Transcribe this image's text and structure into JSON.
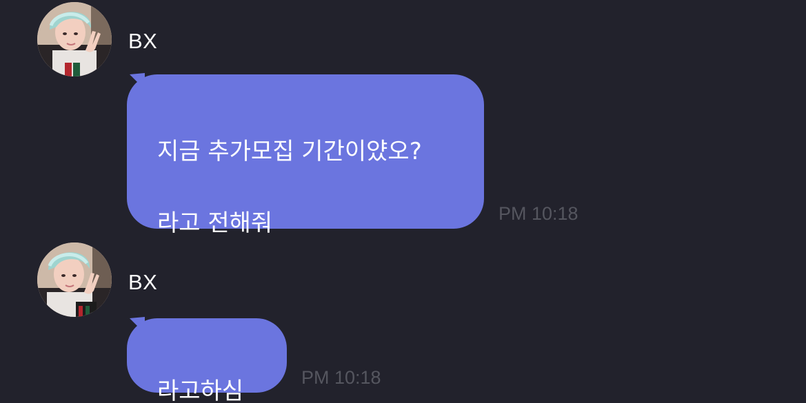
{
  "theme": {
    "background": "#22222c",
    "bubble_color": "#6b75df",
    "text_color": "#ffffff",
    "time_color": "#55565f"
  },
  "messages": [
    {
      "sender": "BX",
      "avatar_icon": "profile-photo-avatar",
      "text": "지금 추가모집 기간이얐오?\n\n라고 전해줘",
      "time": "PM 10:18"
    },
    {
      "sender": "BX",
      "avatar_icon": "profile-photo-avatar",
      "text": "라고하심",
      "time": "PM 10:18"
    }
  ]
}
